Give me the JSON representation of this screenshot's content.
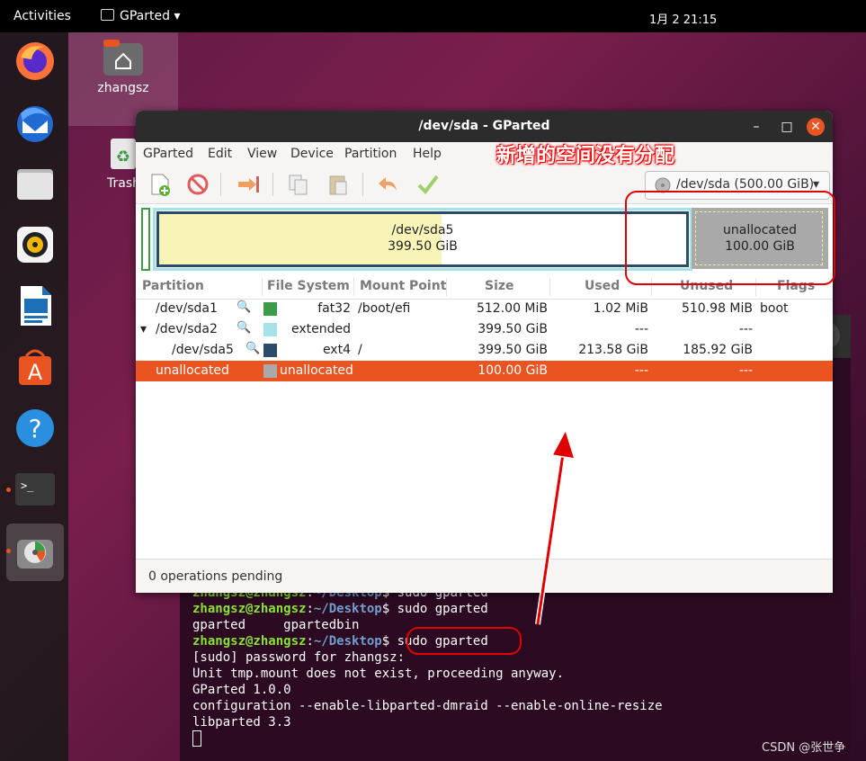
{
  "topbar": {
    "activities": "Activities",
    "app_menu": "GParted",
    "clock": "1月 2  21:15"
  },
  "desktop": {
    "home_label": "zhangsz",
    "trash_label": "Trash"
  },
  "terminal": {
    "lines": [
      {
        "user": "zhangsz@zhangsz",
        "dir": "~/Desktop",
        "cmd": "$ sudo gparted"
      },
      {
        "user": "zhangsz@zhangsz",
        "dir": "~/Desktop",
        "cmd": "$ sudo gparted"
      },
      {
        "text": "gparted     gpartedbin"
      },
      {
        "user": "zhangsz@zhangsz",
        "dir": "~/Desktop",
        "cmd": "sudo gparted"
      },
      {
        "text": "[sudo] password for zhangsz:"
      },
      {
        "text": "Unit tmp.mount does not exist, proceeding anyway."
      },
      {
        "text": "GParted 1.0.0"
      },
      {
        "text": "configuration --enable-libparted-dmraid --enable-online-resize"
      },
      {
        "text": "libparted 3.3"
      }
    ]
  },
  "gparted": {
    "title": "/dev/sda - GParted",
    "menu": [
      "GParted",
      "Edit",
      "View",
      "Device",
      "Partition",
      "Help"
    ],
    "device_selector": "/dev/sda (500.00 GiB)",
    "disk_graphic": {
      "main_name": "/dev/sda5",
      "main_size": "399.50 GiB",
      "unalloc_name": "unallocated",
      "unalloc_size": "100.00 GiB"
    },
    "columns": [
      "Partition",
      "File System",
      "Mount Point",
      "Size",
      "Used",
      "Unused",
      "Flags"
    ],
    "rows": [
      {
        "partition": "/dev/sda1",
        "fs": "fat32",
        "mount": "/boot/efi",
        "size": "512.00 MiB",
        "used": "1.02 MiB",
        "unused": "510.98 MiB",
        "flags": "boot",
        "color": "#3a9c46"
      },
      {
        "partition": "/dev/sda2",
        "fs": "extended",
        "mount": "",
        "size": "399.50 GiB",
        "used": "---",
        "unused": "---",
        "flags": "",
        "color": "#a4e3ea"
      },
      {
        "partition": "/dev/sda5",
        "fs": "ext4",
        "mount": "/",
        "size": "399.50 GiB",
        "used": "213.58 GiB",
        "unused": "185.92 GiB",
        "flags": "",
        "color": "#2c4a6a"
      },
      {
        "partition": "unallocated",
        "fs": "unallocated",
        "mount": "",
        "size": "100.00 GiB",
        "used": "---",
        "unused": "---",
        "flags": "",
        "color": "#a9a9a9"
      }
    ],
    "status": "0 operations pending"
  },
  "annotation": {
    "text": "新增的空间没有分配"
  },
  "watermark": "CSDN @张世争",
  "colors": {
    "accent": "#e95420",
    "annotation_red": "#e00000"
  }
}
